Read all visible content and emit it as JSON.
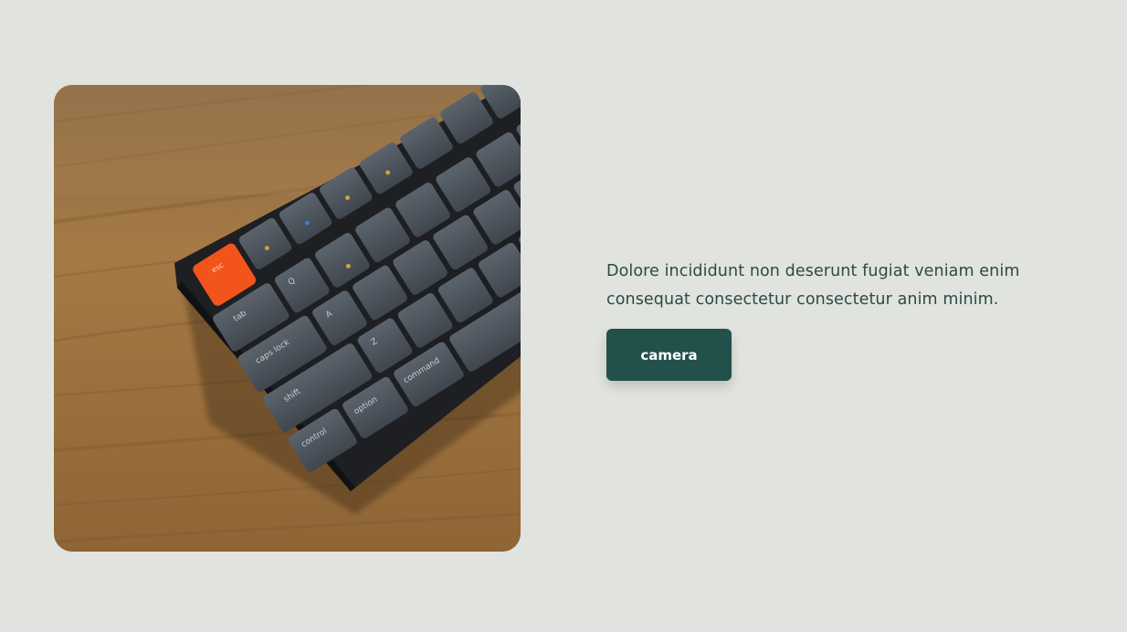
{
  "hero": {
    "image_subject": "mechanical-keyboard-on-wooden-desk",
    "keycaps": {
      "esc": "esc",
      "tab": "tab",
      "caps": "caps lock",
      "shift": "shift",
      "control": "control",
      "command": "command",
      "option": "option",
      "q": "Q",
      "a": "A",
      "z": "Z"
    }
  },
  "content": {
    "line1": "Dolore incididunt non deserunt fugiat veniam enim",
    "line2": "consequat consectetur consectetur anim minim.",
    "button_label": "camera"
  },
  "colors": {
    "background": "#e1e3de",
    "button": "#22504b",
    "text": "#2d4a47",
    "esc_key": "#f2541b"
  }
}
